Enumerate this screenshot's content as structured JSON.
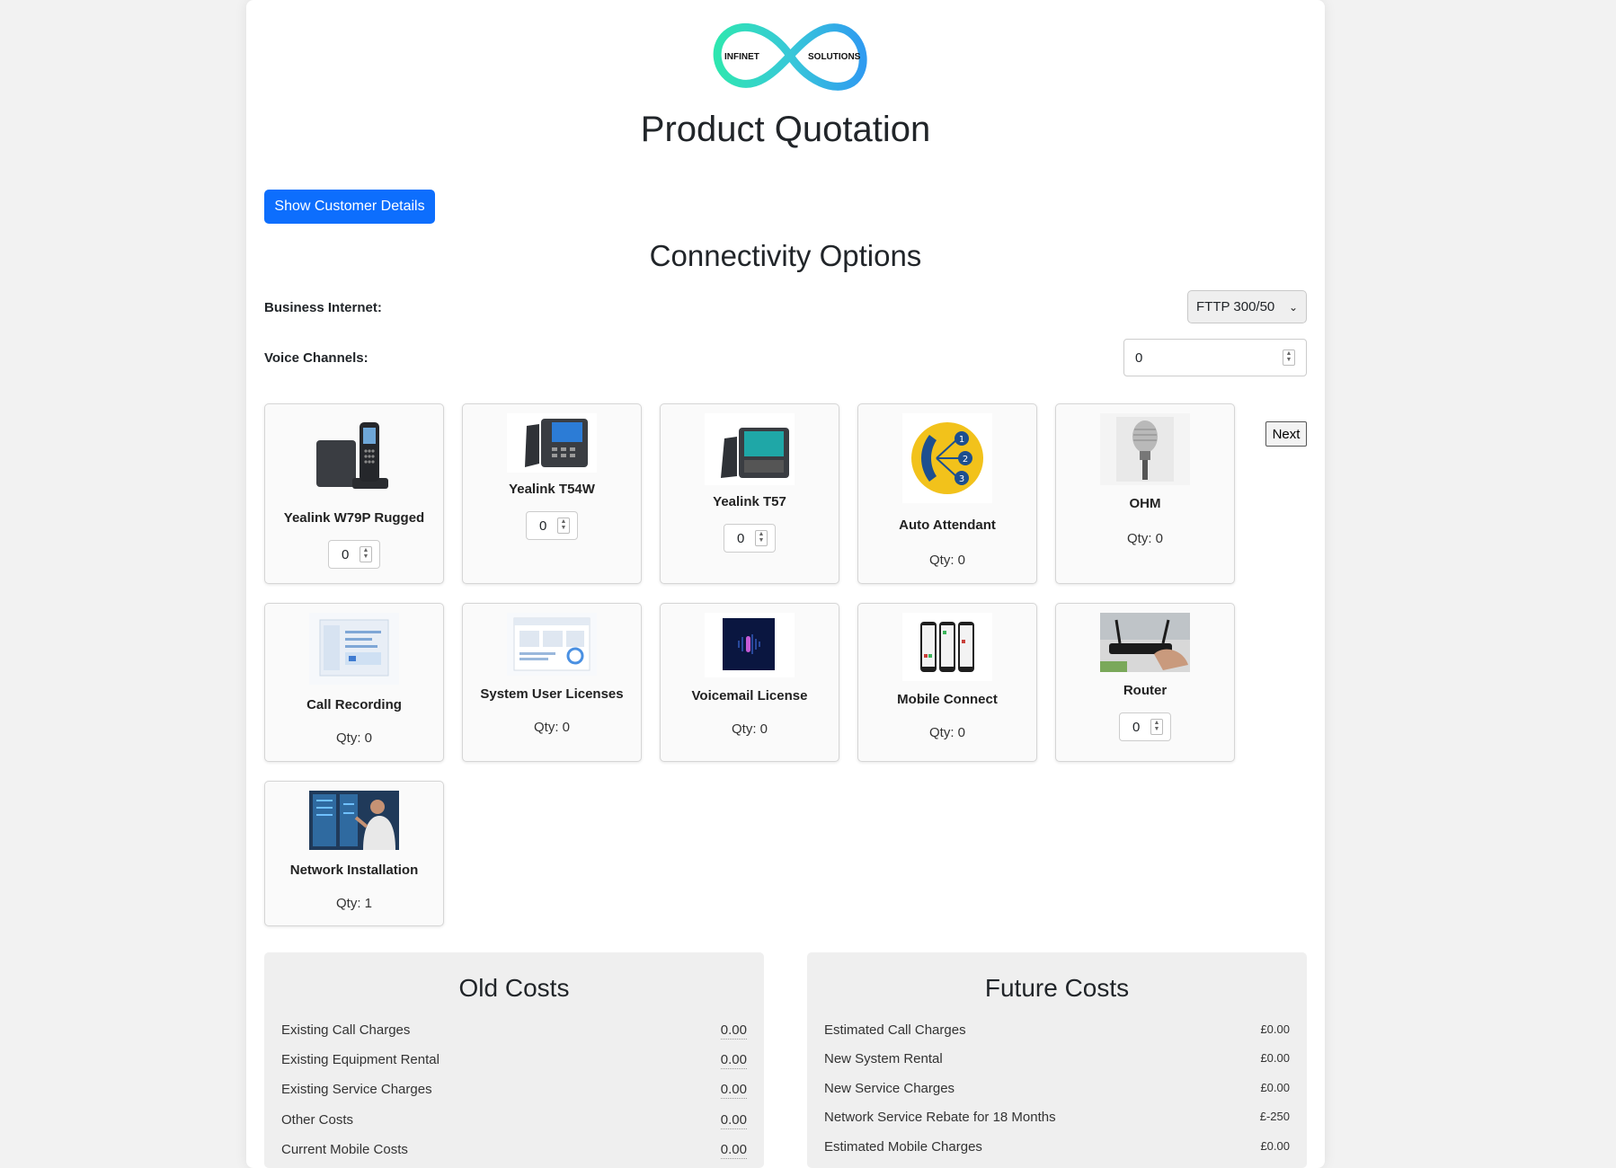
{
  "logo": {
    "left_text": "INFINET",
    "right_text": "SOLUTIONS"
  },
  "page_title": "Product Quotation",
  "show_customer_button": "Show Customer Details",
  "connectivity": {
    "title": "Connectivity Options",
    "business_internet_label": "Business Internet:",
    "business_internet_value": "FTTP 300/50",
    "voice_channels_label": "Voice Channels:",
    "voice_channels_value": "0"
  },
  "next_button": "Next",
  "products": [
    {
      "name": "Yealink W79P Rugged",
      "qty": "0"
    },
    {
      "name": "Yealink T54W",
      "qty": "0"
    },
    {
      "name": "Yealink T57",
      "qty": "0"
    },
    {
      "name": "Auto Attendant",
      "qty": "Qty: 0"
    },
    {
      "name": "OHM",
      "qty": "Qty: 0"
    },
    {
      "name": "Call Recording",
      "qty": "Qty: 0"
    },
    {
      "name": "System User Licenses",
      "qty": "Qty: 0"
    },
    {
      "name": "Voicemail License",
      "qty": "Qty: 0"
    },
    {
      "name": "Mobile Connect",
      "qty": "Qty: 0"
    },
    {
      "name": "Router",
      "qty": "0"
    },
    {
      "name": "Network Installation",
      "qty": "Qty: 1"
    }
  ],
  "old_costs": {
    "title": "Old Costs",
    "rows": [
      {
        "label": "Existing Call Charges",
        "value": "0.00"
      },
      {
        "label": "Existing Equipment Rental",
        "value": "0.00"
      },
      {
        "label": "Existing Service Charges",
        "value": "0.00"
      },
      {
        "label": "Other Costs",
        "value": "0.00"
      },
      {
        "label": "Current Mobile Costs",
        "value": "0.00"
      }
    ]
  },
  "future_costs": {
    "title": "Future Costs",
    "rows": [
      {
        "label": "Estimated Call Charges",
        "value": "£0.00"
      },
      {
        "label": "New System Rental",
        "value": "£0.00"
      },
      {
        "label": "New Service Charges",
        "value": "£0.00"
      },
      {
        "label": "Network Service Rebate for 18 Months",
        "value": "£-250"
      },
      {
        "label": "Estimated Mobile Charges",
        "value": "£0.00"
      }
    ]
  },
  "colors": {
    "primary": "#0d6efd",
    "logo_teal": "#2ee6b0",
    "logo_blue": "#2f9bf0"
  }
}
